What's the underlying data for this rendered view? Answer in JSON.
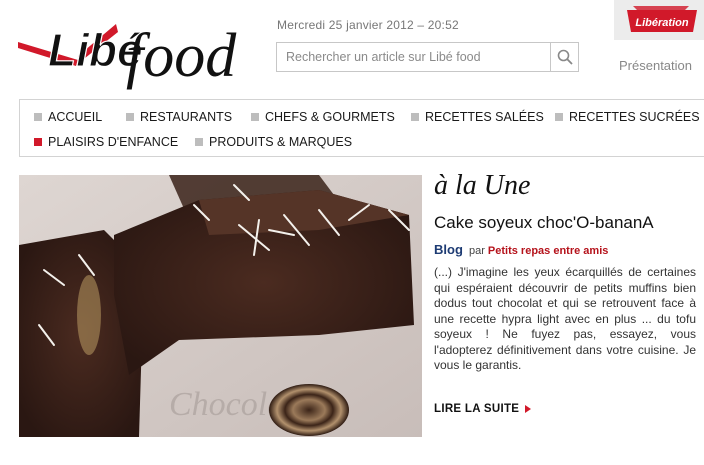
{
  "header": {
    "logo_libe": "Libé",
    "logo_food": "food",
    "date": "Mercredi 25 janvier 2012 – 20:52",
    "search": {
      "placeholder": "Rechercher un article sur Libé food"
    },
    "badge": "Libération",
    "presentation_link": "Présentation"
  },
  "nav": {
    "items": [
      {
        "label": "ACCUEIL",
        "active": false
      },
      {
        "label": "RESTAURANTS",
        "active": false
      },
      {
        "label": "CHEFS & GOURMETS",
        "active": false
      },
      {
        "label": "RECETTES SALÉES",
        "active": false
      },
      {
        "label": "RECETTES SUCRÉES",
        "active": false
      },
      {
        "label": "PLAISIRS D'ENFANCE",
        "active": true
      },
      {
        "label": "PRODUITS & MARQUES",
        "active": false
      }
    ]
  },
  "featured": {
    "section": "à la Une",
    "title": "Cake soyeux choc'O-bananA",
    "category": "Blog",
    "by": "par",
    "author": "Petits repas entre amis",
    "excerpt": "(...) J'imagine les yeux écarquillés de certaines qui espéraient découvrir de petits muffins bien dodus tout chocolat et qui se retrouvent face à une recette hypra light avec en plus ... du tofu soyeux ! Ne fuyez pas, essayez, vous l'adopterez définitivement dans votre cuisine. Je vous le garantis.",
    "read_more": "LIRE LA SUITE",
    "photo_plate_text": "Chocolat"
  },
  "colors": {
    "accent_red": "#d1192a",
    "nav_square": "#bdbdbd",
    "blog_blue": "#1d3b73",
    "author_red": "#b5121b"
  },
  "icons": {
    "search": "search-icon",
    "read_more": "arrow-right-icon"
  }
}
